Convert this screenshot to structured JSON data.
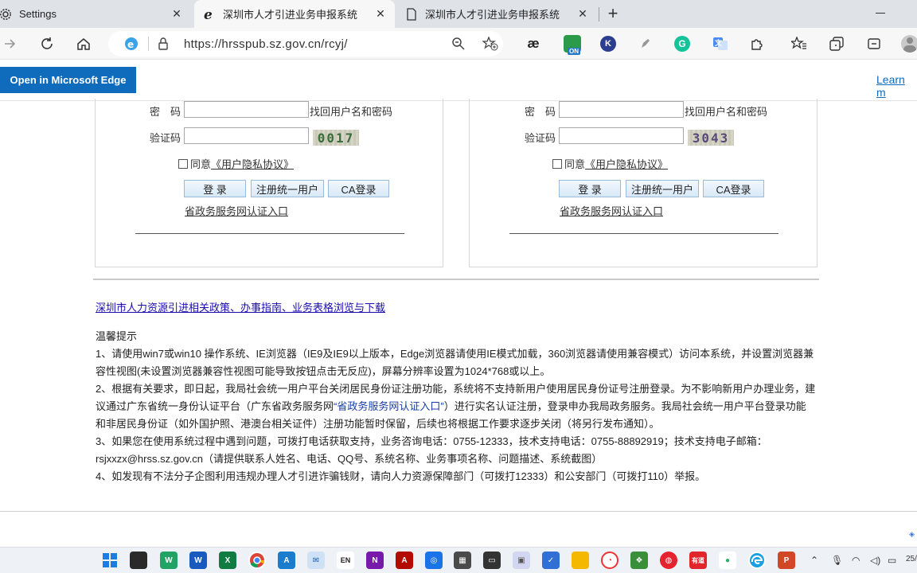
{
  "browser": {
    "tabs": [
      {
        "label": "Settings",
        "icon": "gear-icon"
      },
      {
        "label": "深圳市人才引进业务申报系统",
        "icon": "ie-icon",
        "active": true
      },
      {
        "label": "深圳市人才引进业务申报系统",
        "icon": "page-icon"
      }
    ],
    "url": "https://hrsspub.sz.gov.cn/rcyj/",
    "extensions": [
      "æ",
      "ON",
      "K",
      "G"
    ]
  },
  "infobar": {
    "open_button": "Open in Microsoft Edge",
    "learn_link": "Learn m"
  },
  "login_panels": [
    {
      "password_label": "密　码",
      "find_link": "找回用户名和密码",
      "captcha_label": "验证码",
      "captcha_code": "0017",
      "agree_prefix": "同意",
      "agree_link": "《用户隐私协议》",
      "login_button": "登 录",
      "register_button": "注册统一用户",
      "ca_button": "CA登录",
      "gov_link": "省政务服务网认证入口"
    },
    {
      "password_label": "密　码",
      "find_link": "找回用户名和密码",
      "captcha_label": "验证码",
      "captcha_code": "3043",
      "agree_prefix": "同意",
      "agree_link": "《用户隐私协议》",
      "login_button": "登 录",
      "register_button": "注册统一用户",
      "ca_button": "CA登录",
      "gov_link": "省政务服务网认证入口"
    }
  ],
  "policy_link": "深圳市人力资源引进相关政策、办事指南、业务表格浏览与下载",
  "tips": {
    "title": "温馨提示",
    "item1": "1、请使用win7或win10 操作系统、IE浏览器（IE9及IE9以上版本，Edge浏览器请使用IE模式加载，360浏览器请使用兼容模式）访问本系统，并设置浏览器兼容性视图(未设置浏览器兼容性视图可能导致按钮点击无反应)，屏幕分辨率设置为1024*768或以上。",
    "item2_a": "2、根据有关要求，即日起，我局社会统一用户平台关闭居民身份证注册功能，系统将不支持新用户使用居民身份证号注册登录。为不影响新用户办理业务，建议通过广东省统一身份认证平台（广东省政务服务网",
    "item2_link": "“省政务服务网认证入口”",
    "item2_b": "）进行实名认证注册，登录申办我局政务服务。我局社会统一用户平台登录功能和非居民身份证（如外国护照、港澳台相关证件）注册功能暂时保留，后续也将根据工作要求逐步关闭（将另行发布通知）。",
    "item3": "3、如果您在使用系统过程中遇到问题，可拨打电话获取支持，业务咨询电话：0755-12333，技术支持电话：0755-88892919；技术支持电子邮箱：rsjxxzx@hrss.sz.gov.cn（请提供联系人姓名、电话、QQ号、系统名称、业务事项名称、问题描述、系统截图）",
    "item4": "4、如发现有不法分子企图利用违规办理人才引进诈骗钱财，请向人力资源保障部门（可拨打12333）和公安部门（可拨打110）举报。"
  },
  "taskbar": {
    "date_partial": "25/"
  }
}
